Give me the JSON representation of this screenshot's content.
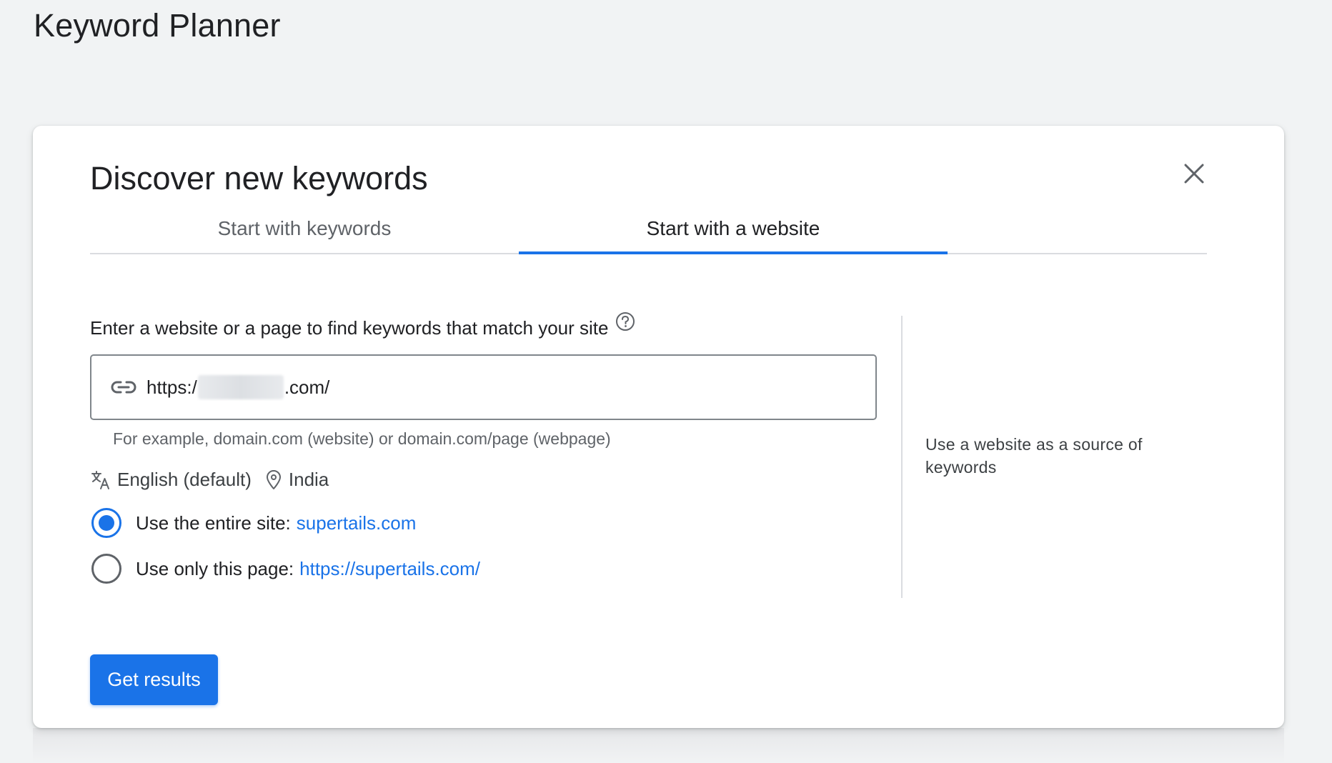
{
  "page": {
    "title": "Keyword Planner"
  },
  "dialog": {
    "title": "Discover new keywords",
    "close_icon": "close-icon",
    "tabs": [
      {
        "label": "Start with keywords",
        "active": false
      },
      {
        "label": "Start with a website",
        "active": true
      }
    ],
    "website_field": {
      "label": "Enter a website or a page to find keywords that match your site",
      "help_icon": "help-circle-icon",
      "leading_icon": "link-icon",
      "value_prefix": "https:/",
      "value_suffix": ".com/",
      "value_redacted": true,
      "helper": "For example, domain.com (website) or domain.com/page (webpage)"
    },
    "language": {
      "icon": "translate-icon",
      "label": "English (default)"
    },
    "location": {
      "icon": "location-pin-icon",
      "label": "India"
    },
    "scope_options": [
      {
        "label": "Use the entire site:",
        "link": "supertails.com",
        "selected": true
      },
      {
        "label": "Use only this page:",
        "link": "https://supertails.com/",
        "selected": false
      }
    ],
    "side_note": "Use a website as a source of keywords",
    "submit_label": "Get results"
  },
  "colors": {
    "accent": "#1a73e8",
    "background": "#f1f3f4",
    "card": "#ffffff",
    "text": "#202124",
    "muted_text": "#5f6368",
    "divider": "#dadce0"
  }
}
